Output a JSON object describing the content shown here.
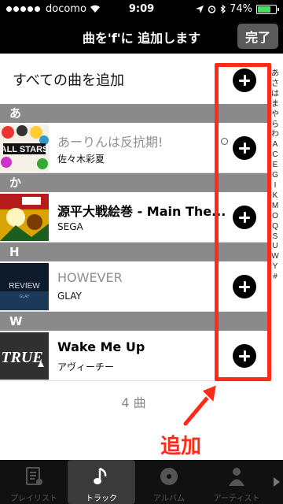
{
  "status": {
    "carrier": "docomo",
    "time": "9:09",
    "battery": "74%",
    "battery_level": 0.74
  },
  "nav": {
    "title": "曲を'f'に 追加します",
    "done_label": "完了"
  },
  "add_all_label": "すべての曲を追加",
  "sections": [
    {
      "header": "あ",
      "track": {
        "title": "あーりんは反抗期!",
        "artist": "佐々木彩夏",
        "dim": true
      }
    },
    {
      "header": "か",
      "track": {
        "title": "源平大戦絵巻 - Main The...",
        "artist": "SEGA",
        "dim": false
      }
    },
    {
      "header": "H",
      "track": {
        "title": "HOWEVER",
        "artist": "GLAY",
        "dim": true
      }
    },
    {
      "header": "W",
      "track": {
        "title": "Wake Me Up",
        "artist": "アヴィーチー",
        "dim": false
      }
    }
  ],
  "count_label": "4 曲",
  "index_letters": [
    "あ",
    "さ",
    "は",
    "ま",
    "や",
    "ら",
    "わ",
    "A",
    "C",
    "E",
    "G",
    "I",
    "K",
    "M",
    "O",
    "Q",
    "S",
    "U",
    "W",
    "Y",
    "#"
  ],
  "annotation_label": "追加",
  "tabs": [
    {
      "label": "プレイリスト",
      "icon": "playlist-icon"
    },
    {
      "label": "トラック",
      "icon": "music-note-icon"
    },
    {
      "label": "アルバム",
      "icon": "album-icon"
    },
    {
      "label": "アーティスト",
      "icon": "artist-icon"
    }
  ],
  "colors": {
    "accent_red": "#ff2a18",
    "section_gray": "#8a8a8a"
  }
}
